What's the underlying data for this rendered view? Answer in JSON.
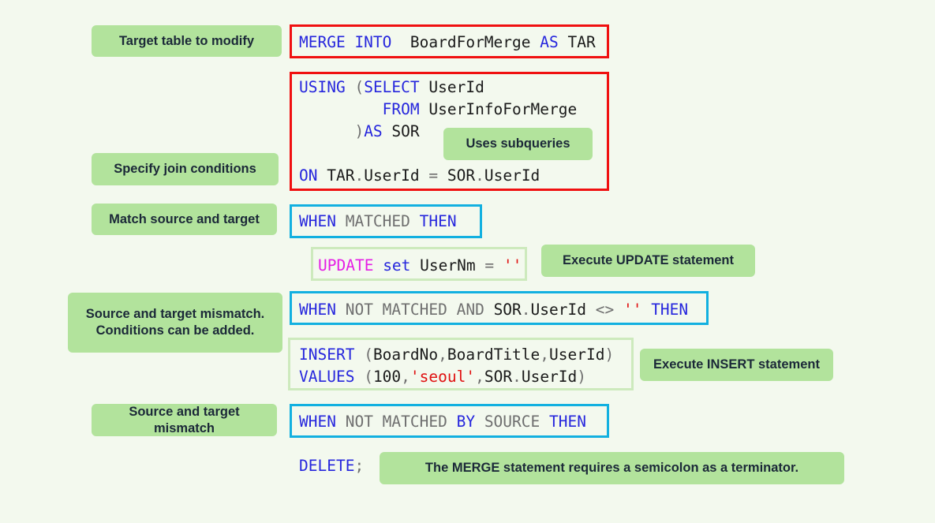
{
  "colors": {
    "keyword": "#2626dd",
    "secondary_keyword": "#6f6f6f",
    "dml_keyword": "#e51ee5",
    "string": "#e01010",
    "label_bg": "#b2e39c",
    "target_box": "#f01010",
    "condition_box": "#12b0e0",
    "action_box": "#cdeabd"
  },
  "code": {
    "merge": [
      [
        {
          "t": "MERGE INTO",
          "c": "k"
        },
        {
          "t": "  BoardForMerge ",
          "c": "n"
        },
        {
          "t": "AS",
          "c": "k"
        },
        {
          "t": " TAR",
          "c": "n"
        }
      ]
    ],
    "using": [
      [
        {
          "t": "USING ",
          "c": "k"
        },
        {
          "t": "(",
          "c": "g"
        },
        {
          "t": "SELECT",
          "c": "k"
        },
        {
          "t": " UserId",
          "c": "n"
        }
      ],
      [
        {
          "t": "         FROM",
          "c": "k"
        },
        {
          "t": " UserInfoForMerge",
          "c": "n"
        }
      ],
      [
        {
          "t": "      )",
          "c": "g"
        },
        {
          "t": "AS",
          "c": "k"
        },
        {
          "t": " SOR",
          "c": "n"
        }
      ],
      [
        {
          "t": "",
          "c": "n"
        }
      ],
      [
        {
          "t": "ON",
          "c": "k"
        },
        {
          "t": " TAR",
          "c": "n"
        },
        {
          "t": ".",
          "c": "g"
        },
        {
          "t": "UserId ",
          "c": "n"
        },
        {
          "t": "=",
          "c": "g"
        },
        {
          "t": " SOR",
          "c": "n"
        },
        {
          "t": ".",
          "c": "g"
        },
        {
          "t": "UserId",
          "c": "n"
        }
      ]
    ],
    "matched": [
      [
        {
          "t": "WHEN",
          "c": "k"
        },
        {
          "t": " MATCHED ",
          "c": "g"
        },
        {
          "t": "THEN",
          "c": "k"
        }
      ]
    ],
    "update": [
      [
        {
          "t": "UPDATE",
          "c": "m"
        },
        {
          "t": " set",
          "c": "k"
        },
        {
          "t": " UserNm ",
          "c": "n"
        },
        {
          "t": "=",
          "c": "g"
        },
        {
          "t": " ''",
          "c": "r"
        }
      ]
    ],
    "not_matched": [
      [
        {
          "t": "WHEN",
          "c": "k"
        },
        {
          "t": " NOT MATCHED AND ",
          "c": "g"
        },
        {
          "t": "SOR",
          "c": "n"
        },
        {
          "t": ".",
          "c": "g"
        },
        {
          "t": "UserId ",
          "c": "n"
        },
        {
          "t": "<>",
          "c": "g"
        },
        {
          "t": " '' ",
          "c": "r"
        },
        {
          "t": "THEN",
          "c": "k"
        }
      ]
    ],
    "insert": [
      [
        {
          "t": "INSERT ",
          "c": "k"
        },
        {
          "t": "(",
          "c": "g"
        },
        {
          "t": "BoardNo",
          "c": "n"
        },
        {
          "t": ",",
          "c": "g"
        },
        {
          "t": "BoardTitle",
          "c": "n"
        },
        {
          "t": ",",
          "c": "g"
        },
        {
          "t": "UserId",
          "c": "n"
        },
        {
          "t": ")",
          "c": "g"
        }
      ],
      [
        {
          "t": "VALUES ",
          "c": "k"
        },
        {
          "t": "(",
          "c": "g"
        },
        {
          "t": "100",
          "c": "n"
        },
        {
          "t": ",",
          "c": "g"
        },
        {
          "t": "'seoul'",
          "c": "r"
        },
        {
          "t": ",",
          "c": "g"
        },
        {
          "t": "SOR",
          "c": "n"
        },
        {
          "t": ".",
          "c": "g"
        },
        {
          "t": "UserId",
          "c": "n"
        },
        {
          "t": ")",
          "c": "g"
        }
      ]
    ],
    "by_source": [
      [
        {
          "t": "WHEN",
          "c": "k"
        },
        {
          "t": " NOT MATCHED ",
          "c": "g"
        },
        {
          "t": "BY",
          "c": "k"
        },
        {
          "t": " SOURCE ",
          "c": "g"
        },
        {
          "t": "THEN",
          "c": "k"
        }
      ]
    ],
    "delete": [
      [
        {
          "t": "DELETE",
          "c": "k"
        },
        {
          "t": ";",
          "c": "g"
        }
      ]
    ]
  },
  "labels": {
    "target": "Target table to modify",
    "join": "Specify join conditions",
    "match": "Match source and target",
    "mismatch_cond_1": "Source and target mismatch.",
    "mismatch_cond_2": "Conditions can be added.",
    "mismatch": "Source and target mismatch",
    "subqueries": "Uses subqueries",
    "update": "Execute UPDATE statement",
    "insert": "Execute INSERT statement",
    "semicolon": "The MERGE statement requires a semicolon as a terminator."
  }
}
